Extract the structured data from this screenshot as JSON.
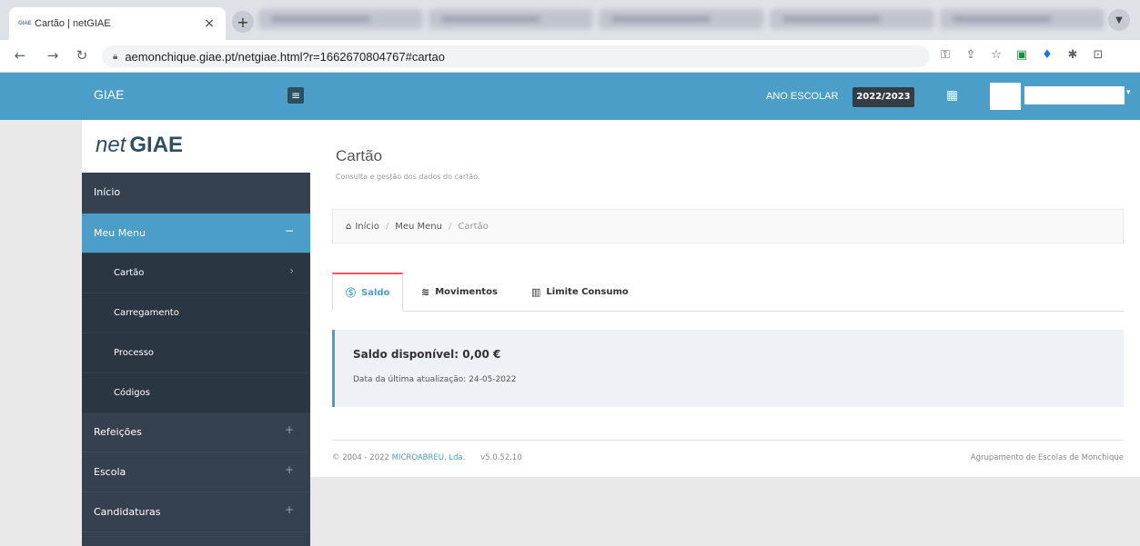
{
  "browser": {
    "tab_favicon": "GIAE",
    "tab_title": "Cartão | netGIAE",
    "tab_close": "×",
    "new_tab": "+",
    "url": "aemonchique.giae.pt/netgiae.html?r=1662670804767#cartao"
  },
  "header": {
    "brand": "GIAE",
    "year_label": "ANO ESCOLAR",
    "year_value": "2022/2023"
  },
  "logo": {
    "prefix": "net",
    "name": "GIAE"
  },
  "sidebar": {
    "items": [
      {
        "label": "Início",
        "trail": ""
      },
      {
        "label": "Meu Menu",
        "trail": "−"
      },
      {
        "label": "Cartão",
        "trail": "›"
      },
      {
        "label": "Carregamento",
        "trail": ""
      },
      {
        "label": "Processo",
        "trail": ""
      },
      {
        "label": "Códigos",
        "trail": ""
      },
      {
        "label": "Refeições",
        "trail": "+"
      },
      {
        "label": "Escola",
        "trail": "+"
      },
      {
        "label": "Candidaturas",
        "trail": "+"
      }
    ]
  },
  "main": {
    "title": "Cartão",
    "subtitle": "Consulta e gestão dos dados do cartão.",
    "breadcrumb": [
      "Início",
      "Meu Menu",
      "Cartão"
    ],
    "tabs": [
      {
        "label": "Saldo",
        "icon": "dollar-circle-icon"
      },
      {
        "label": "Movimentos",
        "icon": "layers-icon"
      },
      {
        "label": "Limite Consumo",
        "icon": "chart-icon"
      }
    ],
    "balance_title": "Saldo disponível: 0,00 €",
    "balance_updated": "Data da última atualização: 24-05-2022"
  },
  "footer": {
    "copyright": "© 2004 - 2022 ",
    "company": "MICROABREU, Lda.",
    "version": "v5.0.52.10",
    "school": "Agrupamento de Escolas de Monchique"
  },
  "colors": {
    "header_blue": "#4a9ec8",
    "sidebar_dark": "#364150",
    "tab_accent": "#f3565d"
  }
}
